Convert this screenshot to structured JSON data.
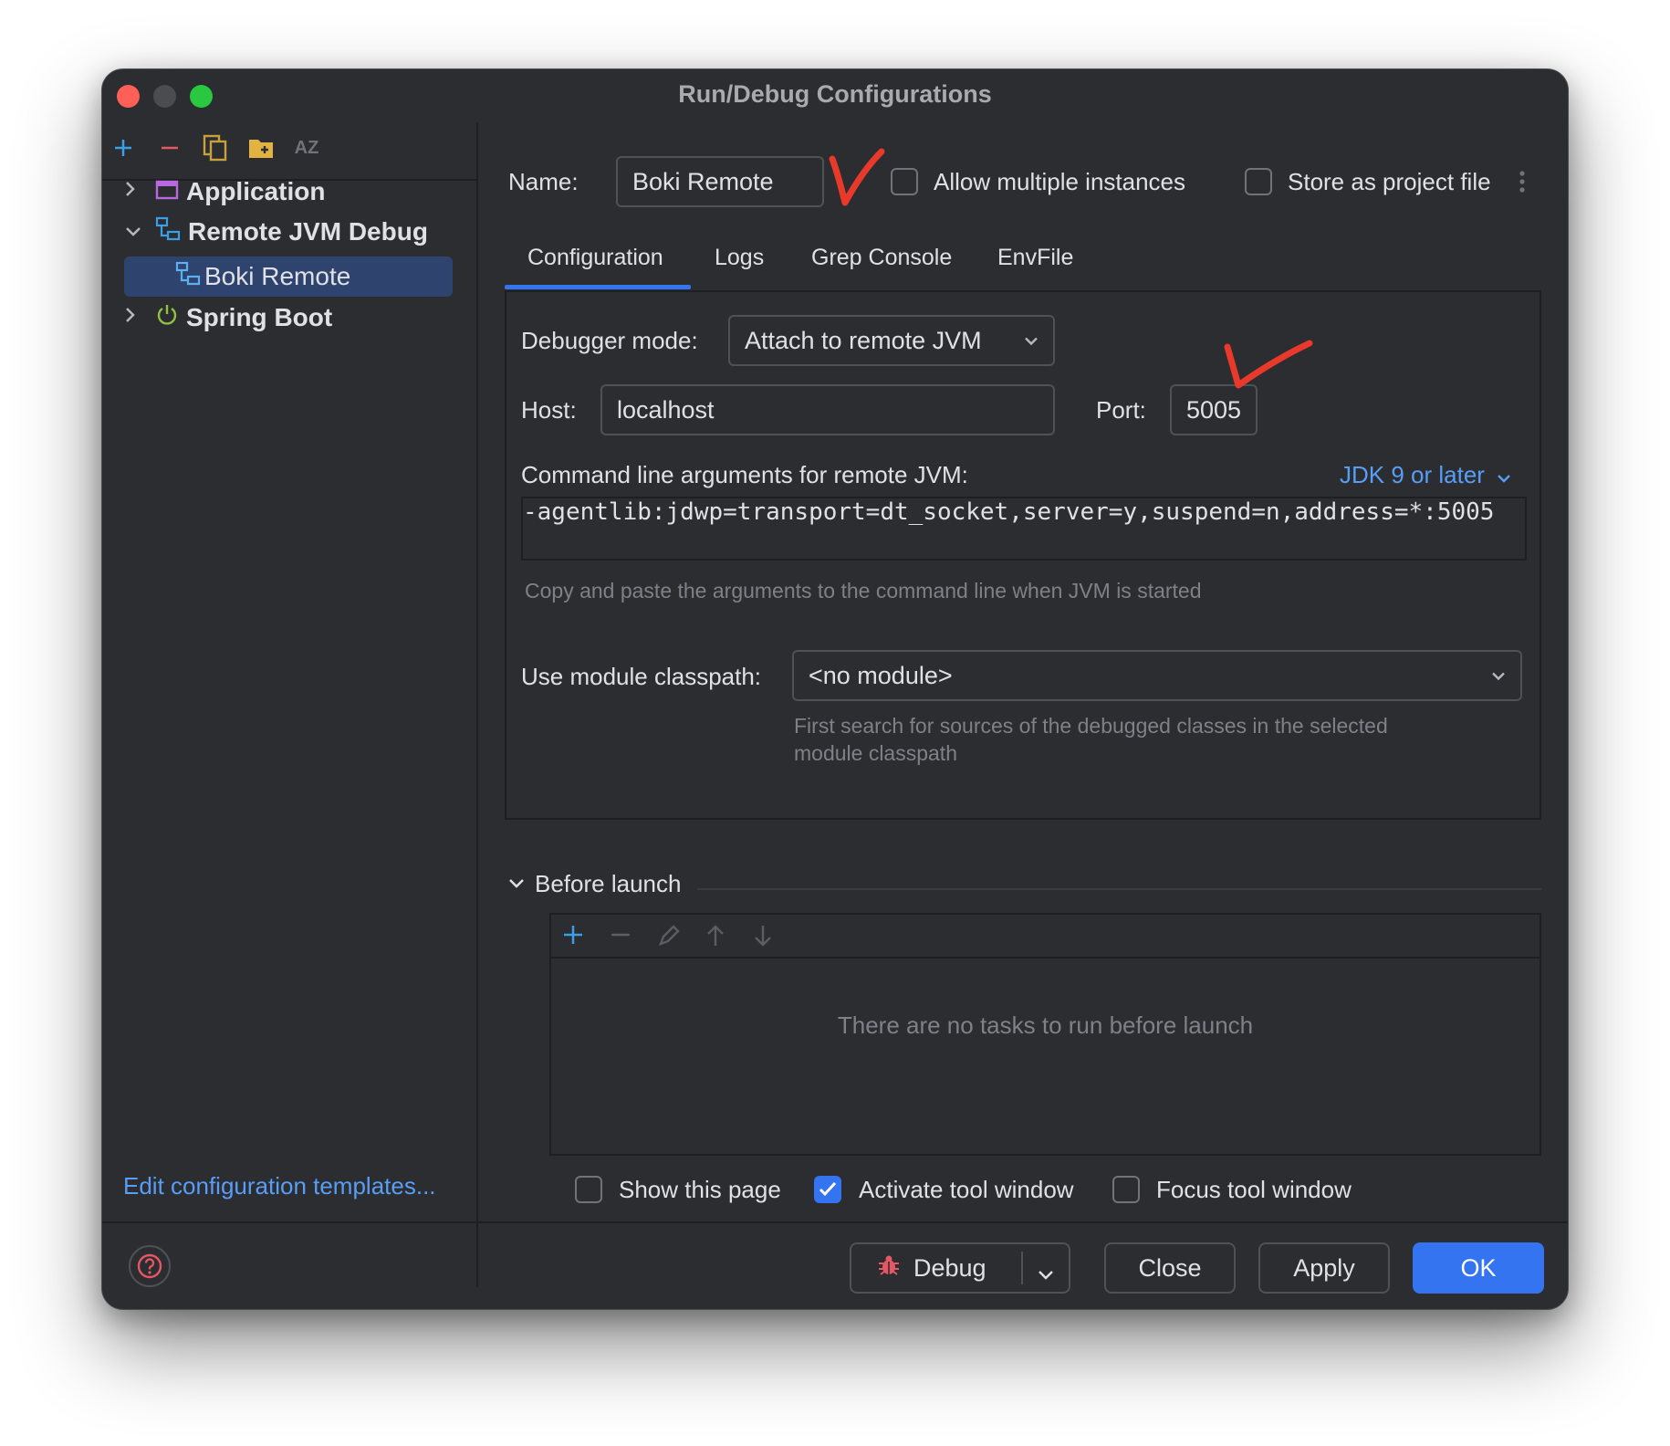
{
  "window": {
    "title": "Run/Debug Configurations"
  },
  "sidebar": {
    "toolbar": [
      "add-icon",
      "remove-icon",
      "copy-icon",
      "new-folder-icon",
      "sort-az-icon"
    ],
    "sort_label": "AZ",
    "tree": [
      {
        "label": "Application",
        "expanded": false
      },
      {
        "label": "Remote JVM Debug",
        "expanded": true
      },
      {
        "label": "Boki Remote",
        "selected": true
      },
      {
        "label": "Spring Boot",
        "expanded": false
      }
    ],
    "edit_templates": "Edit configuration templates..."
  },
  "form": {
    "name_label": "Name:",
    "name_value": "Boki Remote",
    "allow_multiple": "Allow multiple instances",
    "allow_multiple_checked": false,
    "store_project": "Store as project file",
    "store_project_checked": false,
    "tabs": [
      {
        "label": "Configuration",
        "active": true
      },
      {
        "label": "Logs"
      },
      {
        "label": "Grep Console"
      },
      {
        "label": "EnvFile"
      }
    ],
    "debugger_mode_label": "Debugger mode:",
    "debugger_mode_value": "Attach to remote JVM",
    "host_label": "Host:",
    "host_value": "localhost",
    "port_label": "Port:",
    "port_value": "5005",
    "cmd_label": "Command line arguments for remote JVM:",
    "jdk_link": "JDK 9 or later",
    "cmd_value": "-agentlib:jdwp=transport=dt_socket,server=y,suspend=n,address=*:5005",
    "cmd_hint": "Copy and paste the arguments to the command line when JVM is started",
    "module_label": "Use module classpath:",
    "module_value": "<no module>",
    "module_hint_1": "First search for sources of the debugged classes in the selected",
    "module_hint_2": "module classpath"
  },
  "before_launch": {
    "title": "Before launch",
    "empty": "There are no tasks to run before launch",
    "show_page": "Show this page",
    "show_page_checked": false,
    "activate_tool": "Activate tool window",
    "activate_tool_checked": true,
    "focus_tool": "Focus tool window",
    "focus_tool_checked": false
  },
  "footer": {
    "debug": "Debug",
    "close": "Close",
    "apply": "Apply",
    "ok": "OK"
  },
  "colors": {
    "background": "#2b2d30",
    "accent": "#3574f0",
    "link": "#589df6",
    "annotation": "#e8392b"
  }
}
